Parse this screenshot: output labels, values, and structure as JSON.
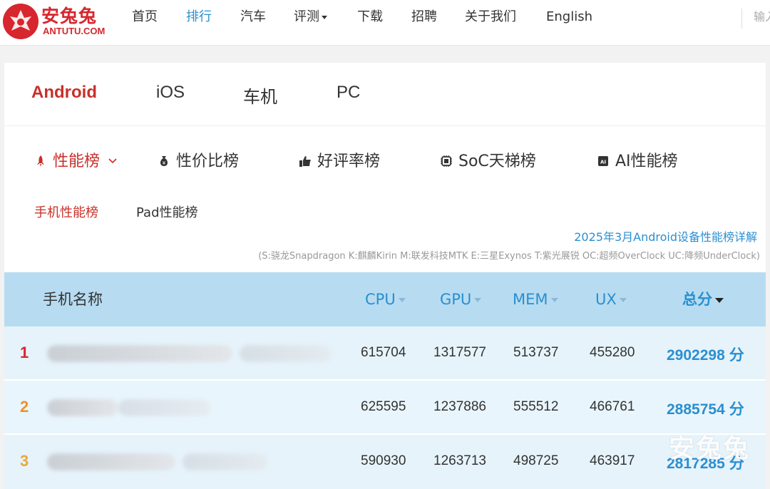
{
  "brand": {
    "logo_cn": "安兔兔",
    "logo_en": "ANTUTU.COM",
    "accent": "#d8262e"
  },
  "nav": {
    "items": [
      {
        "label": "首页"
      },
      {
        "label": "排行",
        "active": true
      },
      {
        "label": "汽车"
      },
      {
        "label": "评测",
        "dropdown": true
      },
      {
        "label": "下载"
      },
      {
        "label": "招聘"
      },
      {
        "label": "关于我们"
      },
      {
        "label": "English"
      }
    ],
    "search_placeholder": "输入"
  },
  "os_tabs": [
    {
      "label": "Android",
      "active": true
    },
    {
      "label": "iOS"
    },
    {
      "label": "车机"
    },
    {
      "label": "PC"
    }
  ],
  "rank_tabs": [
    {
      "label": "性能榜",
      "icon": "rocket-icon",
      "active": true,
      "dropdown": true
    },
    {
      "label": "性价比榜",
      "icon": "money-bag-icon"
    },
    {
      "label": "好评率榜",
      "icon": "thumbs-up-icon"
    },
    {
      "label": "SoC天梯榜",
      "icon": "chip-icon"
    },
    {
      "label": "AI性能榜",
      "icon": "ai-chip-icon"
    }
  ],
  "sub_tabs": [
    {
      "label": "手机性能榜",
      "active": true
    },
    {
      "label": "Pad性能榜"
    }
  ],
  "detail_link": "2025年3月Android设备性能榜详解",
  "legend_note": "(S:骁龙Snapdragon K:麒麟Kirin M:联发科技MTK E:三星Exynos T:紫光展锐 OC:超频OverClock UC:降频UnderClock)",
  "table": {
    "headers": {
      "name": "手机名称",
      "cpu": "CPU",
      "gpu": "GPU",
      "mem": "MEM",
      "ux": "UX",
      "total": "总分"
    },
    "rows": [
      {
        "rank": "1",
        "cpu": "615704",
        "gpu": "1317577",
        "mem": "513737",
        "ux": "455280",
        "total": "2902298",
        "unit": "分",
        "rank_color": "#d8262e"
      },
      {
        "rank": "2",
        "cpu": "625595",
        "gpu": "1237886",
        "mem": "555512",
        "ux": "466761",
        "total": "2885754",
        "unit": "分",
        "rank_color": "#f0902a"
      },
      {
        "rank": "3",
        "cpu": "590930",
        "gpu": "1263713",
        "mem": "498725",
        "ux": "463917",
        "total": "2817285",
        "unit": "分",
        "rank_color": "#e8a83a"
      }
    ]
  },
  "watermark": "安兔兔"
}
